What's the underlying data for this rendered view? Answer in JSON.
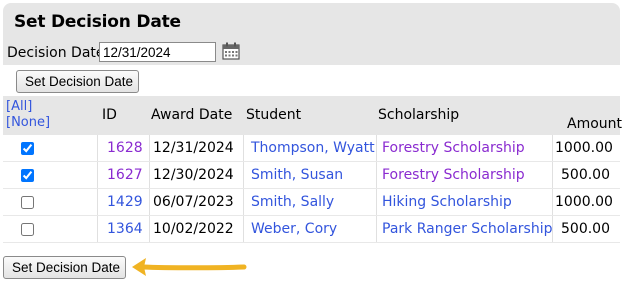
{
  "title": "Set Decision Date",
  "decision_date": {
    "label": "Decision Date",
    "value": "12/31/2024"
  },
  "buttons": {
    "top": "Set Decision Date",
    "bottom": "Set Decision Date"
  },
  "icons": {
    "calendar": "calendar-icon",
    "arrow": "arrow-left-icon"
  },
  "colors": {
    "link": "#3355dd",
    "visited_link": "#8a2bd0",
    "arrow": "#f0b323",
    "panel": "#e6e6e6"
  },
  "table": {
    "select_all": "[All]",
    "select_none": "[None]",
    "headers": {
      "id": "ID",
      "award_date": "Award Date",
      "student": "Student",
      "scholarship": "Scholarship",
      "amount": "Amount"
    },
    "rows": [
      {
        "checked": true,
        "id": "1628",
        "award_date": "12/31/2024",
        "student": "Thompson, Wyatt",
        "scholarship": "Forestry Scholarship",
        "amount": "1000.00",
        "id_visited": true,
        "scholarship_visited": true
      },
      {
        "checked": true,
        "id": "1627",
        "award_date": "12/30/2024",
        "student": "Smith, Susan",
        "scholarship": "Forestry Scholarship",
        "amount": "500.00",
        "id_visited": true,
        "scholarship_visited": true
      },
      {
        "checked": false,
        "id": "1429",
        "award_date": "06/07/2023",
        "student": "Smith, Sally",
        "scholarship": "Hiking Scholarship",
        "amount": "1000.00",
        "id_visited": false,
        "scholarship_visited": false
      },
      {
        "checked": false,
        "id": "1364",
        "award_date": "10/02/2022",
        "student": "Weber, Cory",
        "scholarship": "Park Ranger Scholarship",
        "amount": "500.00",
        "id_visited": false,
        "scholarship_visited": false
      }
    ]
  }
}
